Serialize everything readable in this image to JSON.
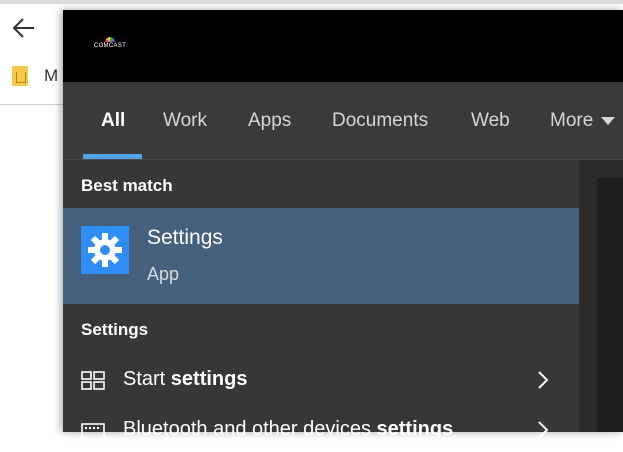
{
  "browser": {
    "back_icon": "back-arrow-icon",
    "bookmark_partial_label": "M",
    "bookmark_icon": "document-icon"
  },
  "panel": {
    "brand": "COMCAST",
    "tabs": [
      {
        "label": "All",
        "active": true
      },
      {
        "label": "Work"
      },
      {
        "label": "Apps"
      },
      {
        "label": "Documents"
      },
      {
        "label": "Web"
      },
      {
        "label": "More"
      }
    ],
    "best_match": {
      "heading": "Best match",
      "title": "Settings",
      "subtitle": "App",
      "icon": "gear-icon"
    },
    "settings_section": {
      "heading": "Settings",
      "items": [
        {
          "label_prefix": "Start ",
          "label_bold": "settings",
          "icon": "start-layout-icon"
        },
        {
          "label_prefix": "Bluetooth and other devices ",
          "label_bold": "settings",
          "icon": "keyboard-icon"
        }
      ]
    },
    "colors": {
      "accent": "#4fa3e8",
      "selected_bg": "#46617e",
      "tile": "#2f8ef5"
    }
  }
}
